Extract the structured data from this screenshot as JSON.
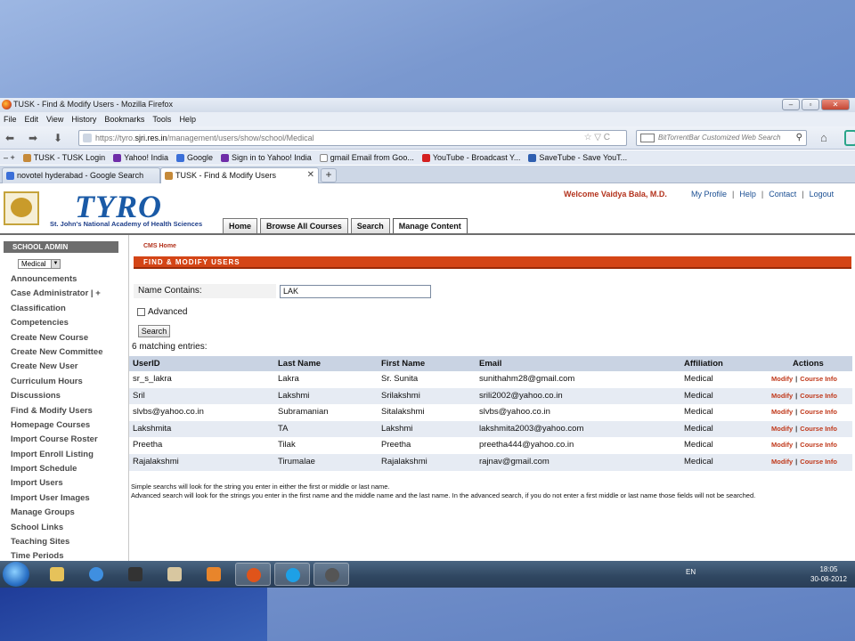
{
  "browser": {
    "window_title": "TUSK - Find & Modify Users - Mozilla Firefox",
    "menu": [
      "File",
      "Edit",
      "View",
      "History",
      "Bookmarks",
      "Tools",
      "Help"
    ],
    "url_prefix": "https://tyro.",
    "url_host": "sjri.res.in",
    "url_path": "/management/users/show/school/Medical",
    "search_placeholder": "BitTorrentBar Customized Web Search",
    "bookmarks": [
      "TUSK - TUSK Login",
      "Yahoo! India",
      "Google",
      "Sign in to Yahoo! India",
      "gmail Email from Goo...",
      "YouTube - Broadcast Y...",
      "SaveTube - Save YouT..."
    ],
    "tabs": [
      "novotel hyderabad - Google Search",
      "TUSK - Find & Modify Users"
    ]
  },
  "header": {
    "brand": "TYRO",
    "subbrand": "St. John's National Academy of Health Sciences",
    "welcome": "Welcome Vaidya Bala, M.D.",
    "links": [
      "My Profile",
      "Help",
      "Contact",
      "Logout"
    ],
    "nav": [
      "Home",
      "Browse All Courses",
      "Search",
      "Manage Content"
    ]
  },
  "sidebar": {
    "header": "SCHOOL ADMIN",
    "school": "Medical",
    "items": [
      "Announcements",
      "Case Administrator | +",
      "Classification",
      "Competencies",
      "Create New Course",
      "Create New Committee",
      "Create New User",
      "Curriculum Hours",
      "Discussions",
      "Find & Modify Users",
      "Homepage Courses",
      "Import Course Roster",
      "Import Enroll Listing",
      "Import Schedule",
      "Import Users",
      "Import User Images",
      "Manage Groups",
      "School Links",
      "Teaching Sites",
      "Time Periods"
    ]
  },
  "main": {
    "breadcrumb": "CMS Home",
    "section_title": "FIND & MODIFY USERS",
    "name_label": "Name Contains:",
    "name_value": "LAK",
    "advanced_label": "Advanced",
    "search_button": "Search",
    "matches": "6 matching entries:",
    "columns": [
      "UserID",
      "Last Name",
      "First Name",
      "Email",
      "Affiliation",
      "Actions"
    ],
    "rows": [
      [
        "sr_s_lakra",
        "Lakra",
        "Sr. Sunita",
        "sunithahm28@gmail.com",
        "Medical"
      ],
      [
        "Sril",
        "Lakshmi",
        "Srilakshmi",
        "srili2002@yahoo.co.in",
        "Medical"
      ],
      [
        "slvbs@yahoo.co.in",
        "Subramanian",
        "Sitalakshmi",
        "slvbs@yahoo.co.in",
        "Medical"
      ],
      [
        "Lakshmita",
        "TA",
        "Lakshmi",
        "lakshmita2003@yahoo.com",
        "Medical"
      ],
      [
        "Preetha",
        "Tilak",
        "Preetha",
        "preetha444@yahoo.co.in",
        "Medical"
      ],
      [
        "Rajalakshmi",
        "Tirumalae",
        "Rajalakshmi",
        "rajnav@gmail.com",
        "Medical"
      ]
    ],
    "action_modify": "Modify",
    "action_course": "Course Info",
    "note1": "Simple searchs will look for the string you enter in either the first or middle or last name.",
    "note2": "Advanced search will look for the strings you enter in the first name and the middle name and the last name. In the advanced search, if you do not enter a first middle or last name those fields will not be searched."
  },
  "taskbar": {
    "lang": "EN",
    "time": "18:05",
    "date": "30-08-2012"
  }
}
